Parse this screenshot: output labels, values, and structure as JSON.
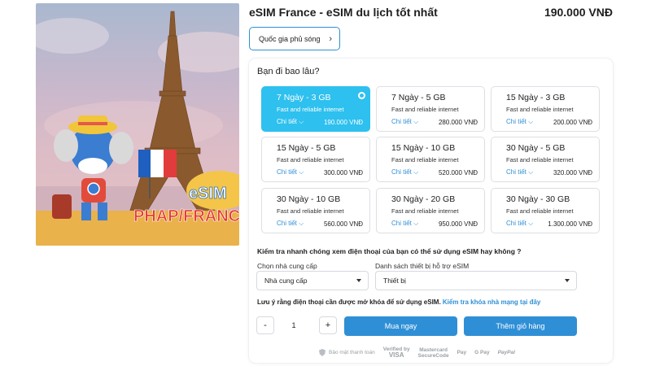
{
  "product": {
    "title": "eSIM France - eSIM du lịch tốt nhất",
    "price": "190.000 VNĐ",
    "image_text": {
      "esim": "eSIM",
      "label": "PHAP/FRANCE"
    }
  },
  "coverage_button": {
    "label": "Quốc gia phủ sóng"
  },
  "duration_question": "Bạn đi bao lâu?",
  "plans": [
    {
      "name": "7 Ngày - 3 GB",
      "desc": "Fast and reliable internet",
      "detail": "Chi tiết",
      "price": "190.000 VNĐ",
      "selected": true
    },
    {
      "name": "7 Ngày - 5 GB",
      "desc": "Fast and reliable internet",
      "detail": "Chi tiết",
      "price": "280.000 VNĐ",
      "selected": false
    },
    {
      "name": "15 Ngày - 3 GB",
      "desc": "Fast and reliable internet",
      "detail": "Chi tiết",
      "price": "200.000 VNĐ",
      "selected": false
    },
    {
      "name": "15 Ngày - 5 GB",
      "desc": "Fast and reliable internet",
      "detail": "Chi tiết",
      "price": "300.000 VNĐ",
      "selected": false
    },
    {
      "name": "15 Ngày - 10 GB",
      "desc": "Fast and reliable internet",
      "detail": "Chi tiết",
      "price": "520.000 VNĐ",
      "selected": false
    },
    {
      "name": "30 Ngày - 5 GB",
      "desc": "Fast and reliable internet",
      "detail": "Chi tiết",
      "price": "320.000 VNĐ",
      "selected": false
    },
    {
      "name": "30 Ngày - 10 GB",
      "desc": "Fast and reliable internet",
      "detail": "Chi tiết",
      "price": "560.000 VNĐ",
      "selected": false
    },
    {
      "name": "30 Ngày - 20 GB",
      "desc": "Fast and reliable internet",
      "detail": "Chi tiết",
      "price": "950.000 VNĐ",
      "selected": false
    },
    {
      "name": "30 Ngày - 30 GB",
      "desc": "Fast and reliable internet",
      "detail": "Chi tiết",
      "price": "1.300.000 VNĐ",
      "selected": false
    }
  ],
  "compat": {
    "question": "Kiểm tra nhanh chóng xem điện thoại của bạn có thể sử dụng eSIM hay không ?",
    "carrier_label": "Chọn nhà cung cấp",
    "carrier_value": "Nhà cung cấp",
    "device_label": "Danh sách thiết bị hỗ trợ eSIM",
    "device_value": "Thiết bị",
    "unlock_note": "Lưu ý rằng điện thoại cần được mở khóa để sử dụng eSIM.",
    "unlock_link": "Kiểm tra khóa nhà mạng tại đây"
  },
  "purchase": {
    "minus": "-",
    "quantity": "1",
    "plus": "+",
    "buy_now": "Mua ngay",
    "add_to_cart": "Thêm giỏ hàng"
  },
  "payments": {
    "secure": "Bảo mật thanh toán",
    "visa_top": "Verified by",
    "visa_bottom": "VISA",
    "mc_top": "Mastercard",
    "mc_bottom": "SecureCode",
    "apple_pay": "Pay",
    "google_pay": "G Pay",
    "paypal": "PayPal"
  },
  "colors": {
    "accent": "#2f8fd6",
    "selected_plan": "#2ec0ee"
  }
}
